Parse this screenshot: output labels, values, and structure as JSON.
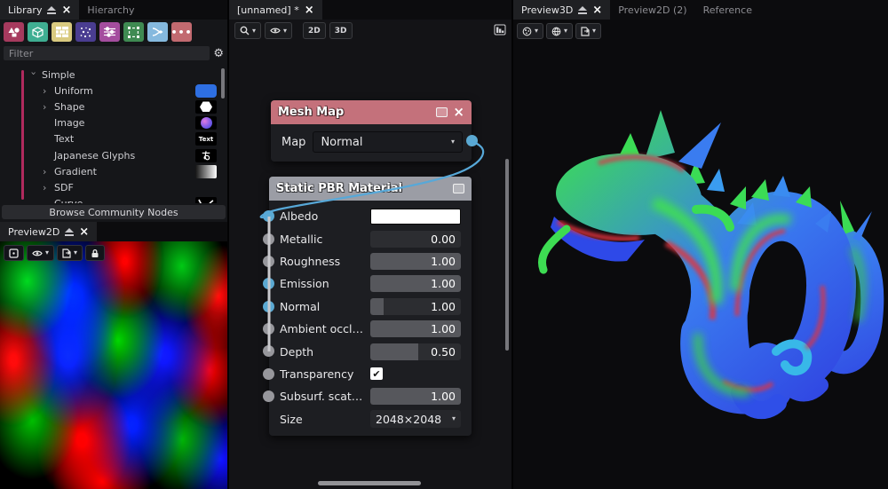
{
  "icons": {
    "close": "×",
    "caret_down": "▾",
    "chevron": "›",
    "gear": "⚙",
    "check": "✔",
    "dots": "•••"
  },
  "colors": {
    "accent_wire": "#57a8d8",
    "port_cyan": "#5ba9d2",
    "port_gray": "#97979c",
    "node_header_mesh": "#c4717b",
    "node_header_pbr": "#9b9da5",
    "tree_accent": "#b02a5d",
    "category_icon_colors": [
      "#a63a5e",
      "#3fae92",
      "#d9ca80",
      "#4a3d91",
      "#a44d9e",
      "#3f8a52",
      "#85b9de",
      "#c26a70"
    ]
  },
  "library": {
    "tabs": [
      {
        "label": "Library",
        "active": true
      },
      {
        "label": "Hierarchy",
        "active": false
      }
    ],
    "category_icons": [
      "shapes",
      "cube",
      "bricks",
      "noise",
      "sliders",
      "transform",
      "workflow",
      "more"
    ],
    "filter_placeholder": "Filter",
    "tree": [
      {
        "label": "Simple"
      },
      {
        "label": "Uniform"
      },
      {
        "label": "Shape"
      },
      {
        "label": "Image"
      },
      {
        "label": "Text",
        "thumb_text": "Text"
      },
      {
        "label": "Japanese Glyphs"
      },
      {
        "label": "Gradient"
      },
      {
        "label": "SDF"
      },
      {
        "label": "Curve"
      }
    ],
    "browse_button": "Browse Community Nodes"
  },
  "preview2d": {
    "tab": "Preview2D"
  },
  "graph": {
    "tab": "[unnamed] *",
    "toolbar": {
      "mode_2d": "2D",
      "mode_3d": "3D"
    },
    "mesh_map": {
      "title": "Mesh Map",
      "param_label": "Map",
      "param_value": "Normal"
    },
    "pbr": {
      "title": "Static PBR Material",
      "params": [
        {
          "label": "Albedo"
        },
        {
          "label": "Metallic",
          "value": "0.00"
        },
        {
          "label": "Roughness",
          "value": "1.00"
        },
        {
          "label": "Emission",
          "value": "1.00"
        },
        {
          "label": "Normal",
          "value": "1.00"
        },
        {
          "label": "Ambient occl…",
          "value": "1.00"
        },
        {
          "label": "Depth",
          "value": "0.50"
        },
        {
          "label": "Transparency"
        },
        {
          "label": "Subsurf. scat…",
          "value": "1.00"
        },
        {
          "label": "Size",
          "value": "2048×2048"
        }
      ]
    }
  },
  "preview3d": {
    "tabs": [
      {
        "label": "Preview3D",
        "active": true
      },
      {
        "label": "Preview2D (2)",
        "active": false
      },
      {
        "label": "Reference",
        "active": false
      }
    ]
  }
}
